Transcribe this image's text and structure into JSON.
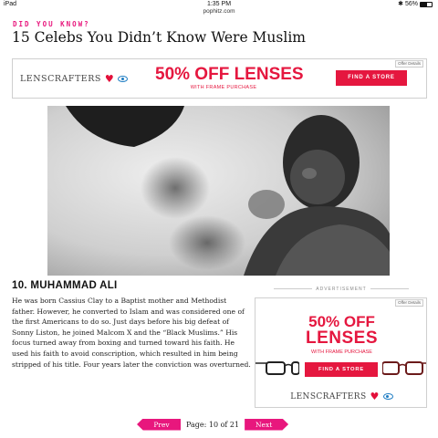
{
  "status_bar": {
    "device": "iPad",
    "time": "1:35 PM",
    "battery": "56%",
    "battery_level": 0.56,
    "url": "pophitz.com"
  },
  "header": {
    "kicker": "DID YOU KNOW?",
    "headline": "15 Celebs You Didn’t Know Were Muslim"
  },
  "top_ad": {
    "ad_choices": "Offer Details",
    "logo": "LENSCRAFTERS",
    "headline": "50% OFF LENSES",
    "subtext": "WITH FRAME PURCHASE",
    "button": "FIND A STORE"
  },
  "article": {
    "title": "10. MUHAMMAD ALI",
    "body": "He was born Cassius Clay to a Baptist mother and Methodist father. However, he converted to Islam and was considered one of the first Americans to do so. Just days before his big defeat of Sonny Liston, he joined Malcom X and the “Black Muslims.” His focus turned away from boxing and turned toward his faith. He used his faith to avoid conscription, which resulted in him being stripped of his title. Four years later the conviction was overturned."
  },
  "side_ad": {
    "label": "ADVERTISEMENT",
    "ad_choices": "Offer Details",
    "line1": "50% OFF",
    "line2": "LENSES",
    "subtext": "WITH FRAME PURCHASE",
    "button": "FIND A STORE",
    "logo": "LENSCRAFTERS"
  },
  "pager": {
    "prev": "Prev",
    "info": "Page: 10 of 21",
    "next": "Next"
  },
  "colors": {
    "accent_pink": "#e8177d",
    "ad_red": "#e5173f"
  }
}
